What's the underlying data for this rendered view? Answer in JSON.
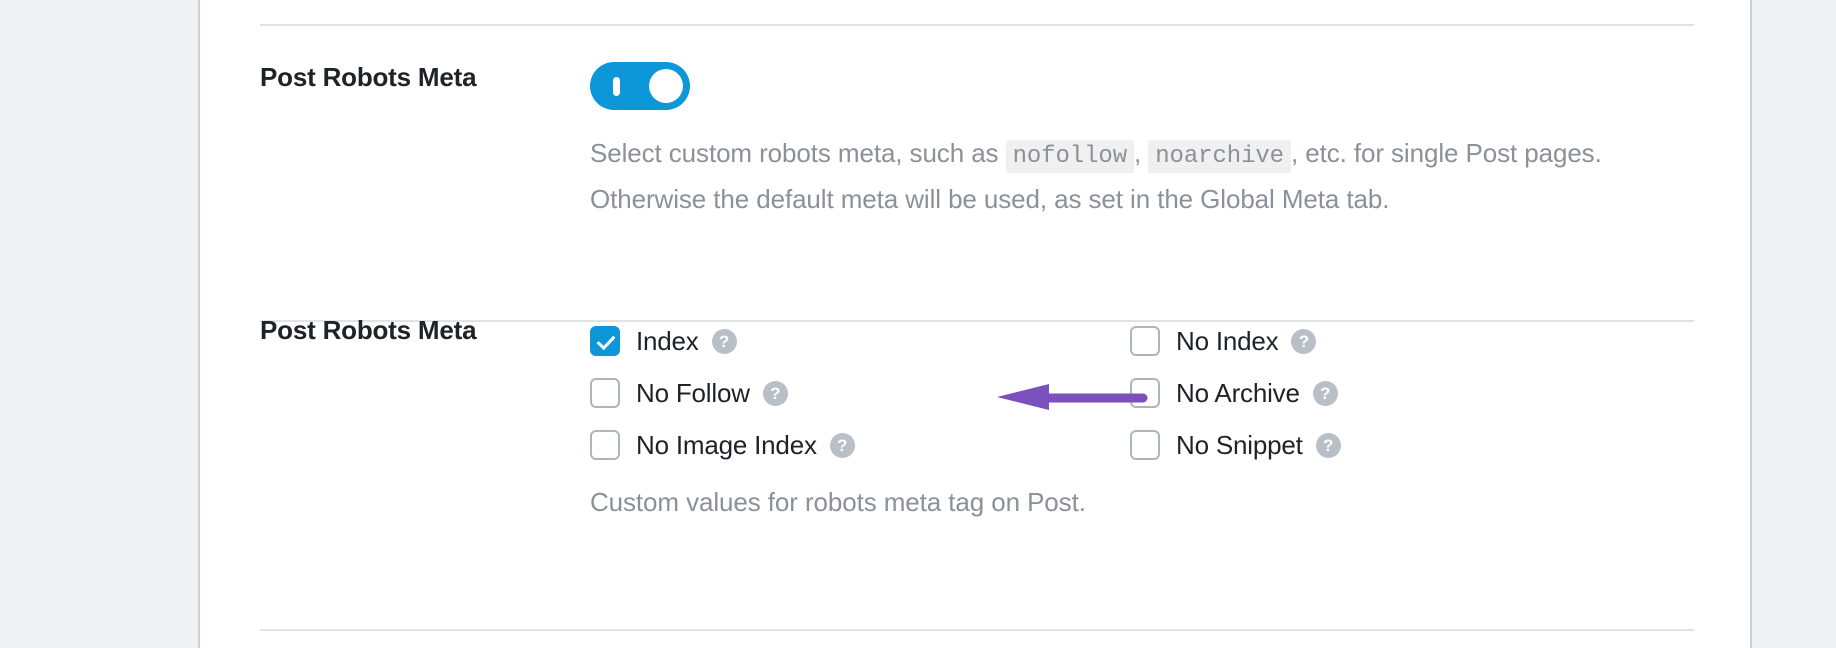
{
  "theme": {
    "accent_blue": "#0d96d8",
    "page_background": "#eff1f3",
    "panel_background": "#ffffff",
    "muted_text": "#8a9199",
    "heading_text": "#1d2327",
    "separator": "#dfe3e6",
    "annotation_purple": "#7c4fbe"
  },
  "rows": {
    "toggle_row": {
      "label": "Post Robots Meta",
      "toggle": {
        "name": "post-robots-meta-toggle",
        "state": "on",
        "aria_label": "Post Robots Meta"
      },
      "description": {
        "part1": "Select custom robots meta, such as",
        "code1": "nofollow",
        "comma1": ",",
        "code2": "noarchive",
        "part2": ", etc. for single Post pages. Otherwise the default meta will be used, as set in the Global Meta tab."
      }
    },
    "checkbox_row": {
      "label": "Post Robots Meta",
      "left_column": [
        {
          "label": "Index",
          "checked": true,
          "help": "?"
        },
        {
          "label": "No Follow",
          "checked": false,
          "help": "?"
        },
        {
          "label": "No Image Index",
          "checked": false,
          "help": "?"
        }
      ],
      "right_column": [
        {
          "label": "No Index",
          "checked": false,
          "help": "?"
        },
        {
          "label": "No Archive",
          "checked": false,
          "help": "?"
        },
        {
          "label": "No Snippet",
          "checked": false,
          "help": "?"
        }
      ],
      "caption": "Custom values for robots meta tag on Post."
    }
  }
}
